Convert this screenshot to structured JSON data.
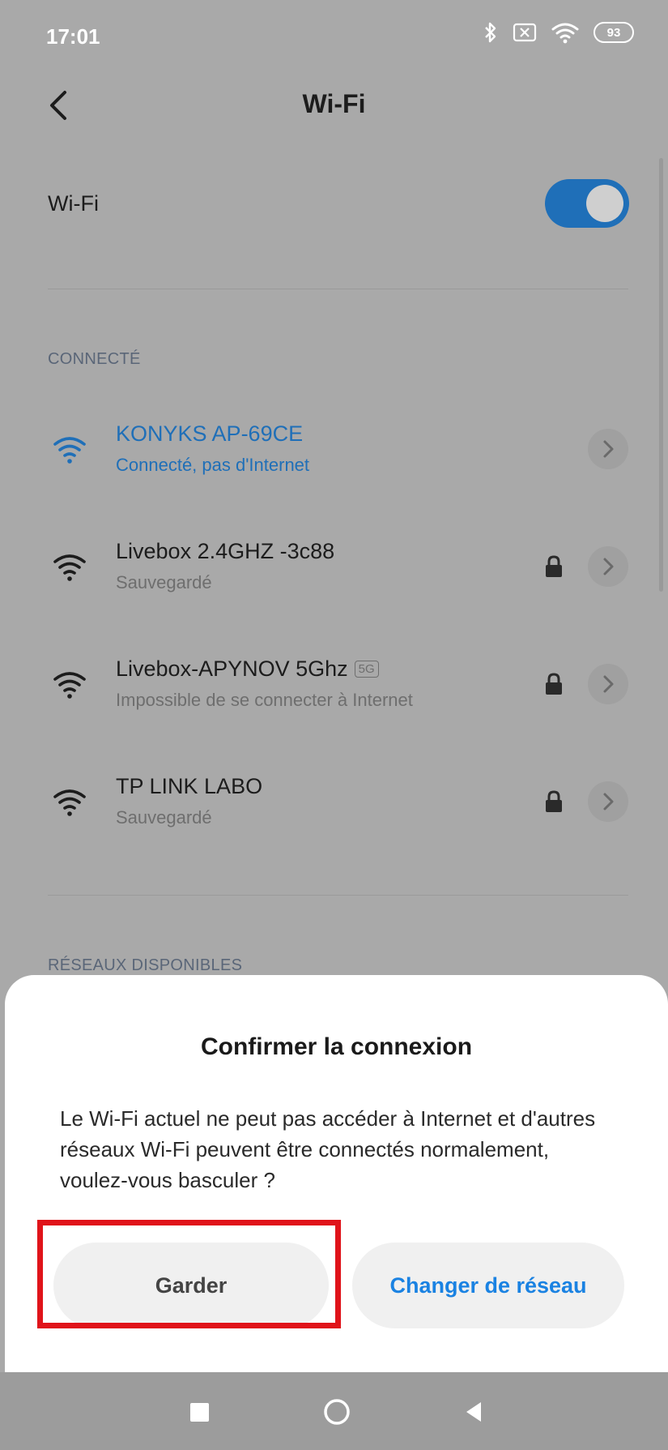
{
  "status_bar": {
    "time": "17:01",
    "battery": "93"
  },
  "header": {
    "title": "Wi-Fi"
  },
  "wifi_toggle": {
    "label": "Wi-Fi",
    "enabled": true
  },
  "sections": {
    "connected": "CONNECTÉ",
    "available": "RÉSEAUX DISPONIBLES"
  },
  "networks": [
    {
      "name": "KONYKS AP-69CE",
      "status": "Connecté, pas d'Internet"
    },
    {
      "name": "Livebox 2.4GHZ -3c88",
      "status": "Sauvegardé"
    },
    {
      "name": "Livebox-APYNOV 5Ghz",
      "badge": "5G",
      "status": "Impossible de se connecter à Internet"
    },
    {
      "name": "TP LINK LABO",
      "status": "Sauvegardé"
    }
  ],
  "dialog": {
    "title": "Confirmer la connexion",
    "message": "Le Wi-Fi actuel ne peut pas accéder à Internet et d'autres réseaux Wi-Fi peuvent être connectés normalement, voulez-vous basculer ?",
    "keep_label": "Garder",
    "change_label": "Changer de réseau"
  },
  "colors": {
    "accent": "#1a82e2",
    "connected": "#1f6fb8",
    "highlight": "#e0131a"
  }
}
